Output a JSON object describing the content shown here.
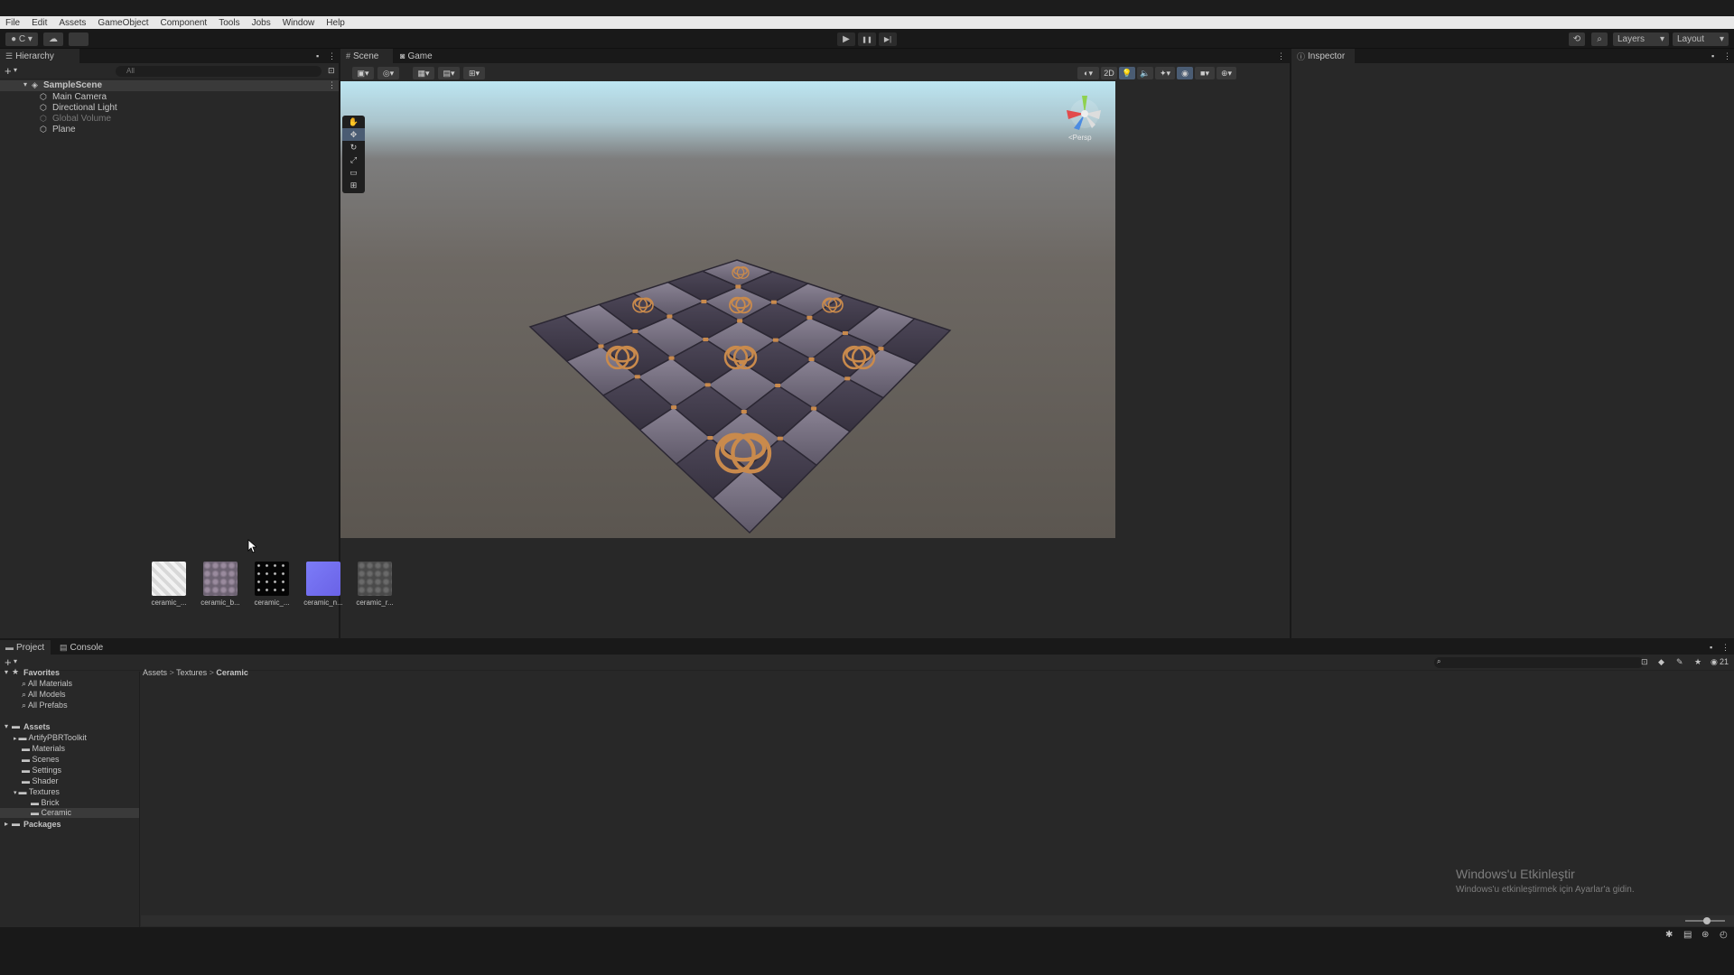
{
  "menu": [
    "File",
    "Edit",
    "Assets",
    "GameObject",
    "Component",
    "Tools",
    "Jobs",
    "Window",
    "Help"
  ],
  "toolbar": {
    "account_label": "C",
    "play": "▶",
    "pause": "❚❚",
    "step": "▶|",
    "layers_label": "Layers",
    "layout_label": "Layout"
  },
  "hierarchy": {
    "tab": "Hierarchy",
    "search_placeholder": "All",
    "scene": "SampleScene",
    "items": [
      {
        "label": "Main Camera",
        "active": true
      },
      {
        "label": "Directional Light",
        "active": true
      },
      {
        "label": "Global Volume",
        "active": false
      },
      {
        "label": "Plane",
        "active": true
      }
    ]
  },
  "scene_view": {
    "tabs": [
      "Scene",
      "Game"
    ],
    "mode_2d": "2D",
    "persp_label": "<Persp"
  },
  "inspector": {
    "tab": "Inspector"
  },
  "project": {
    "tabs": [
      "Project",
      "Console"
    ],
    "favorites_label": "Favorites",
    "favorites": [
      "All Materials",
      "All Models",
      "All Prefabs"
    ],
    "assets_label": "Assets",
    "assets_tree": [
      "ArtifyPBRToolkit",
      "Materials",
      "Scenes",
      "Settings",
      "Shader",
      "Textures",
      "Brick",
      "Ceramic"
    ],
    "packages_label": "Packages",
    "breadcrumb": [
      "Assets",
      "Textures",
      "Ceramic"
    ],
    "thumbnails": [
      {
        "label": "ceramic_..."
      },
      {
        "label": "ceramic_b..."
      },
      {
        "label": "ceramic_..."
      },
      {
        "label": "ceramic_n..."
      },
      {
        "label": "ceramic_r..."
      }
    ],
    "count_badge": "21"
  },
  "watermark": {
    "title": "Windows'u Etkinleştir",
    "subtitle": "Windows'u etkinleştirmek için Ayarlar'a gidin."
  }
}
